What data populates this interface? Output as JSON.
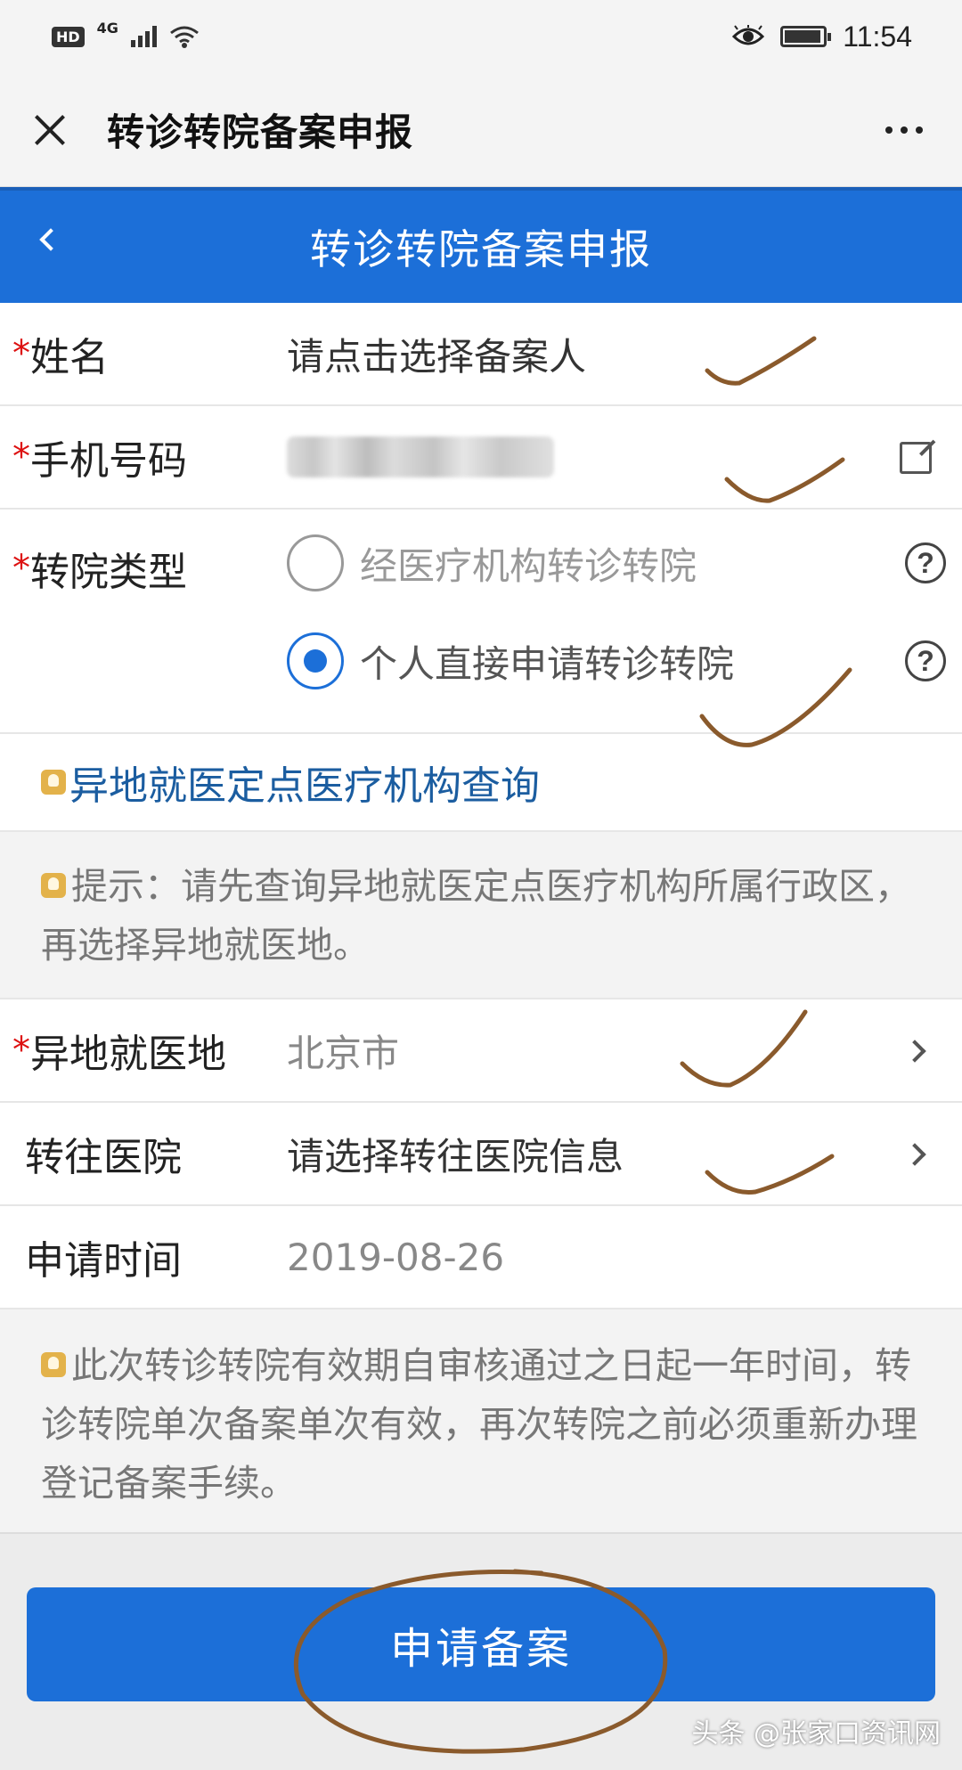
{
  "status_bar": {
    "hd": "HD",
    "network": "4G",
    "time": "11:54"
  },
  "titlebar": {
    "title": "转诊转院备案申报"
  },
  "header": {
    "title": "转诊转院备案申报"
  },
  "form": {
    "name": {
      "label": "姓名",
      "placeholder": "请点击选择备案人"
    },
    "phone": {
      "label": "手机号码"
    },
    "transfer_type": {
      "label": "转院类型",
      "options": [
        {
          "label": "经医疗机构转诊转院",
          "selected": false
        },
        {
          "label": "个人直接申请转诊转院",
          "selected": true
        }
      ]
    },
    "query_link": "异地就医定点医疗机构查询",
    "tip": "提示：请先查询异地就医定点医疗机构所属行政区，再选择异地就医地。",
    "location": {
      "label": "异地就医地",
      "value": "北京市"
    },
    "hospital": {
      "label": "转往医院",
      "placeholder": "请选择转往医院信息"
    },
    "apply_time": {
      "label": "申请时间",
      "value": "2019-08-26"
    },
    "validity_notice": "此次转诊转院有效期自审核通过之日起一年时间，转诊转院单次备案单次有效，再次转院之前必须重新办理登记备案手续。"
  },
  "buttons": {
    "apply": "申请备案"
  },
  "watermark": "头条 @张家口资讯网",
  "colors": {
    "primary": "#1c6fd8",
    "required": "#d11111",
    "link": "#1b5da0",
    "annotation": "#8a5a2c"
  }
}
